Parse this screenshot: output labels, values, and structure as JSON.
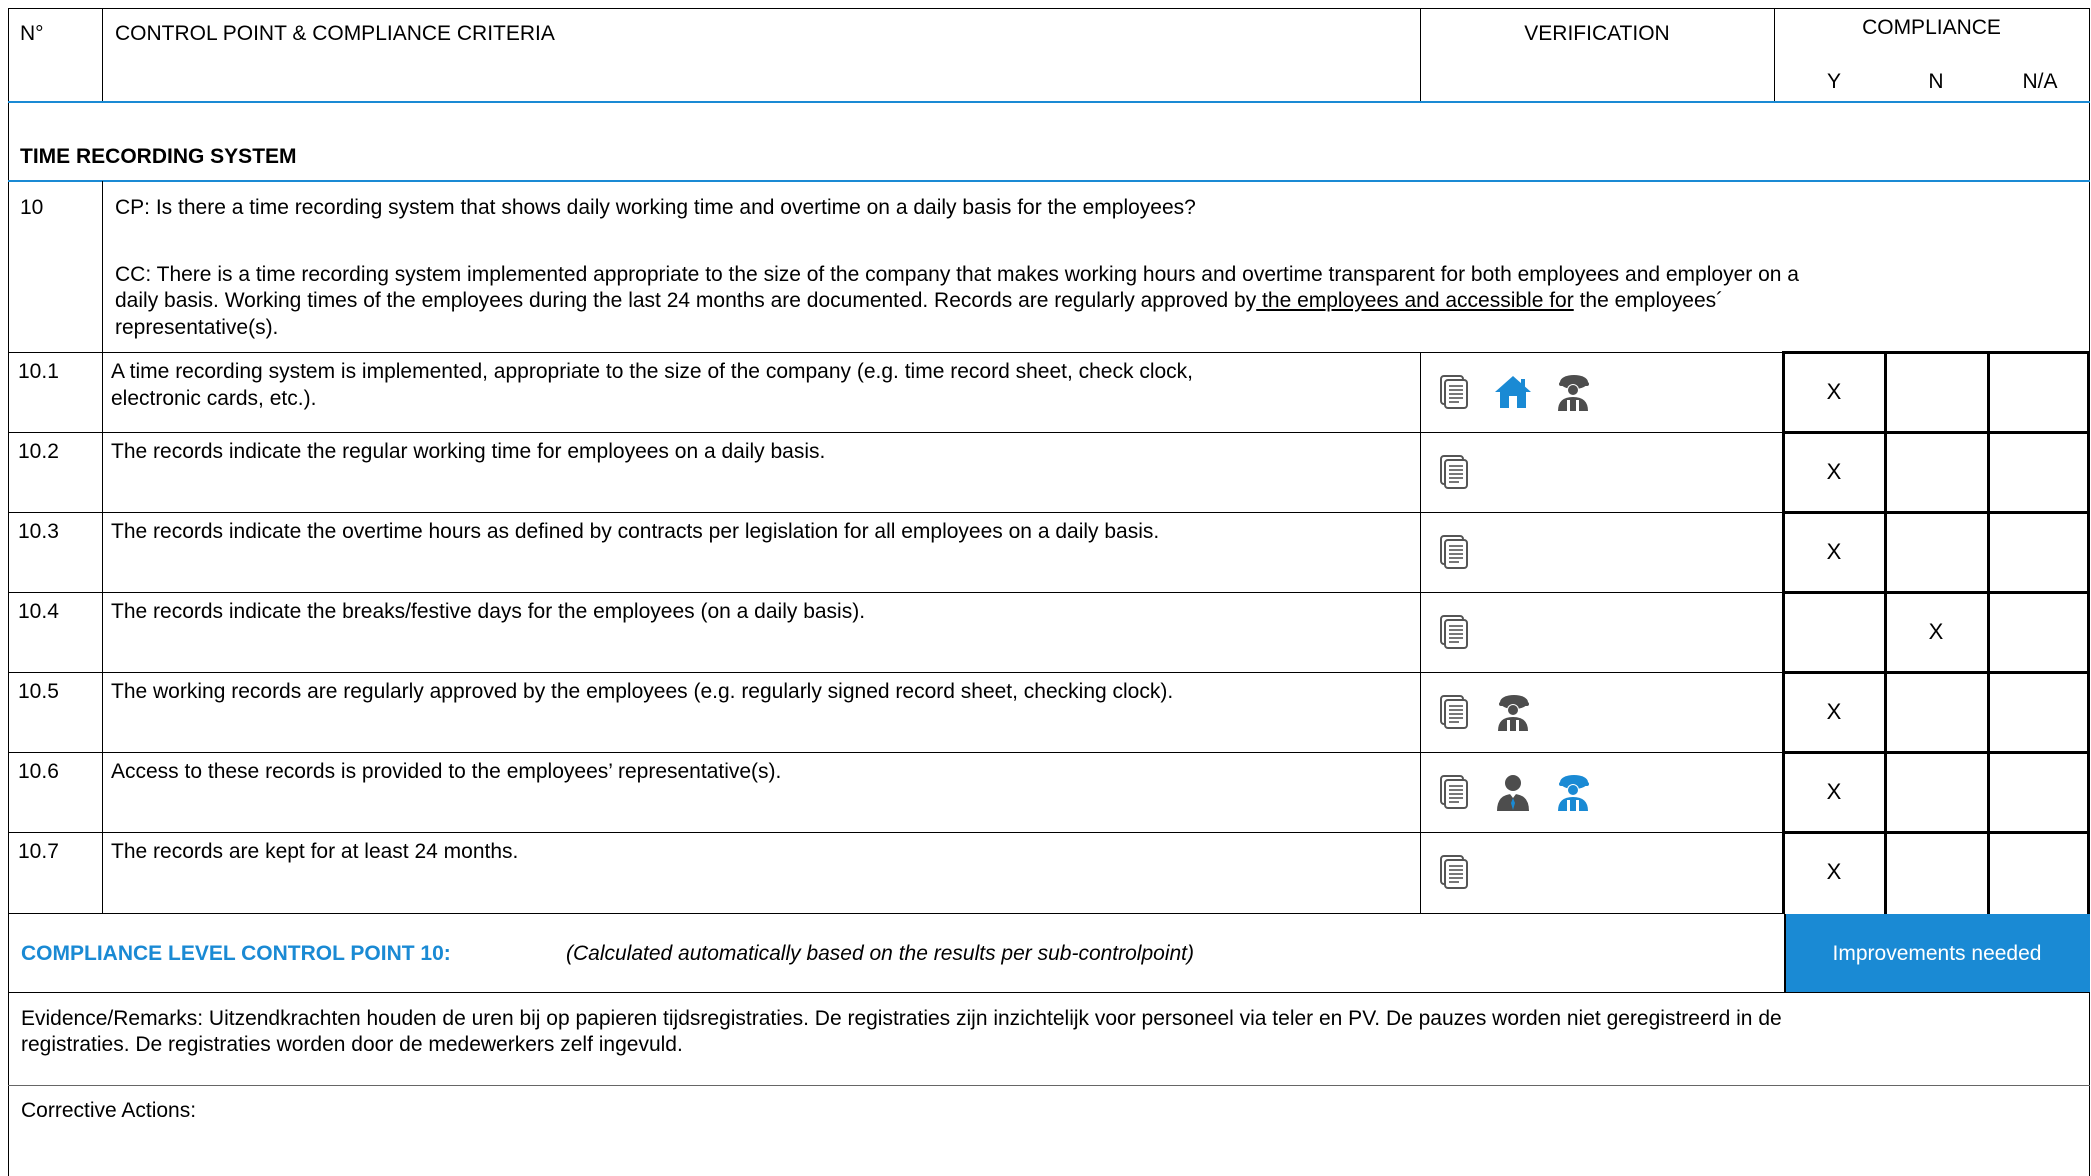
{
  "header": {
    "no": "N°",
    "control_point": "CONTROL POINT & COMPLIANCE CRITERIA",
    "verification": "VERIFICATION",
    "compliance": "COMPLIANCE",
    "y": "Y",
    "n": "N",
    "na": "N/A"
  },
  "section": {
    "title": "TIME RECORDING SYSTEM"
  },
  "control_point": {
    "number": "10",
    "cp": "CP: Is there a time recording system that shows daily working time and overtime on a daily basis for the employees?",
    "cc_line1": "CC: There is a time recording system implemented appropriate to the size of the company that makes working hours and overtime transparent for both employees and employer on a",
    "cc_line2_pre": "daily basis. Working times of the employees during the last 24 months are documented. Records are regularly approved by",
    "cc_line2_underline": " the employees and accessible for",
    "cc_line2_post": " the employees´",
    "cc_line3": "representative(s)."
  },
  "rows": [
    {
      "no": "10.1",
      "line1": "A time recording system is implemented, appropriate to the size of the company (e.g. time record sheet, check clock,",
      "line2": "electronic cards, etc.).",
      "y": "X",
      "n": "",
      "na": "",
      "icons": [
        "document-icon",
        "site-house-icon",
        "worker-icon"
      ]
    },
    {
      "no": "10.2",
      "line1": "The records indicate the regular working time for employees on a daily basis.",
      "line2": "",
      "y": "X",
      "n": "",
      "na": "",
      "icons": [
        "document-icon"
      ]
    },
    {
      "no": "10.3",
      "line1": "The records indicate the overtime hours as defined by contracts per legislation for all employees on a daily basis.",
      "line2": "",
      "y": "X",
      "n": "",
      "na": "",
      "icons": [
        "document-icon"
      ]
    },
    {
      "no": "10.4",
      "line1": "The records indicate the breaks/festive days for the employees (on a daily basis).",
      "line2": "",
      "y": "",
      "n": "X",
      "na": "",
      "icons": [
        "document-icon"
      ]
    },
    {
      "no": "10.5",
      "line1": "The working records are regularly approved by the employees (e.g. regularly signed record sheet, checking clock).",
      "line2": "",
      "y": "X",
      "n": "",
      "na": "",
      "icons": [
        "document-icon",
        "worker-icon"
      ]
    },
    {
      "no": "10.6",
      "line1": "Access to these records is provided to the employees’ representative(s).",
      "line2": "",
      "y": "X",
      "n": "",
      "na": "",
      "icons": [
        "document-icon",
        "manager-icon",
        "worker-representative-icon"
      ]
    },
    {
      "no": "10.7",
      "line1": "The records are kept for at least 24 months.",
      "line2": "",
      "y": "X",
      "n": "",
      "na": "",
      "icons": [
        "document-icon"
      ]
    }
  ],
  "compliance_level": {
    "label": "COMPLIANCE LEVEL CONTROL POINT 10:",
    "note": "(Calculated automatically based on the results per sub-controlpoint)",
    "result": "Improvements needed"
  },
  "evidence": {
    "line1": "Evidence/Remarks: Uitzendkrachten houden de uren bij op papieren tijdsregistraties. De registraties zijn inzichtelijk voor personeel via teler en PV. De pauzes worden niet geregistreerd in de",
    "line2": "registraties. De registraties worden door de medewerkers zelf ingevuld."
  },
  "corrective": {
    "label": "Corrective Actions:"
  },
  "colors": {
    "accent": "#1a8ad4",
    "icon_gray": "#4d4d4d",
    "border": "#000000"
  }
}
